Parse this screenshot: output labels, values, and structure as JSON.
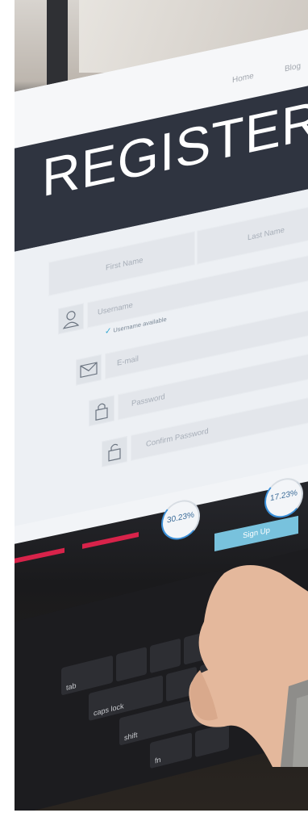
{
  "nav": {
    "links": [
      "Home",
      "Blog"
    ]
  },
  "hero": {
    "title": "REGISTER"
  },
  "form": {
    "first_name_placeholder": "First Name",
    "last_name_placeholder": "Last Name",
    "username_placeholder": "Username",
    "username_status": "Username available",
    "email_placeholder": "E-mail",
    "password_placeholder": "Password",
    "confirm_password_placeholder": "Confirm Password",
    "submit_label": "Sign Up"
  },
  "stats": [
    {
      "value": "30.23%"
    },
    {
      "value": "17.23%"
    }
  ],
  "keyboard": {
    "keys": [
      "tab",
      "caps lock",
      "shift",
      "fn"
    ]
  },
  "colors": {
    "hero_background": "#2f3440",
    "signup_button": "#78c2dd",
    "check_mark": "#2aa3cf",
    "accent_bar": "#d8234a"
  },
  "icons": [
    "user-icon",
    "envelope-icon",
    "lock-icon",
    "unlock-icon",
    "check-icon"
  ]
}
